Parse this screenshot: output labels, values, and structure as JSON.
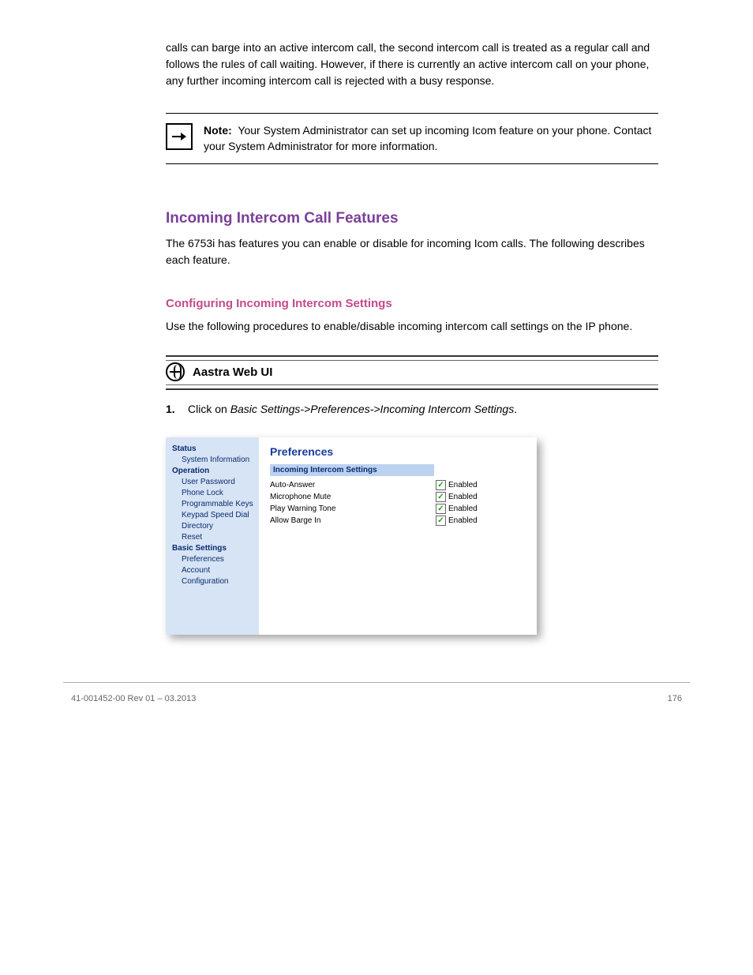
{
  "intro": "calls can barge into an active intercom call, the second intercom call is treated as a regular call and follows the rules of call waiting. However, if there is currently an active intercom call on your phone, any further incoming intercom call is rejected with a busy response.",
  "note": {
    "label": "Note:",
    "text": "Your System Administrator can set up incoming Icom feature on your phone. Contact your System Administrator for more information."
  },
  "section": {
    "title": "Incoming Intercom Call Features",
    "body": "The 6753i has features you can enable or disable for incoming Icom calls. The following describes each feature."
  },
  "sub": {
    "title": "Configuring Incoming Intercom Settings",
    "body": "Use the following procedures to enable/disable incoming intercom call settings on the IP phone."
  },
  "webui_label": "Aastra Web UI",
  "step": {
    "num": "1.",
    "pre": "Click on",
    "path": "Basic Settings->Preferences->Incoming Intercom Settings"
  },
  "shot": {
    "sidebar": {
      "status": "Status",
      "status_items": [
        "System Information"
      ],
      "operation": "Operation",
      "operation_items": [
        "User Password",
        "Phone Lock",
        "Programmable Keys",
        "Keypad Speed Dial",
        "Directory",
        "Reset"
      ],
      "basic": "Basic Settings",
      "basic_items": [
        "Preferences",
        "Account Configuration"
      ]
    },
    "main": {
      "title": "Preferences",
      "subhead": "Incoming Intercom Settings",
      "rows": [
        {
          "label": "Auto-Answer",
          "checked": true,
          "text": "Enabled"
        },
        {
          "label": "Microphone Mute",
          "checked": true,
          "text": "Enabled"
        },
        {
          "label": "Play Warning Tone",
          "checked": true,
          "text": "Enabled"
        },
        {
          "label": "Allow Barge In",
          "checked": true,
          "text": "Enabled"
        }
      ]
    }
  },
  "footer": {
    "left": "41-001452-00 Rev 01 – 03.2013",
    "right": "176"
  }
}
